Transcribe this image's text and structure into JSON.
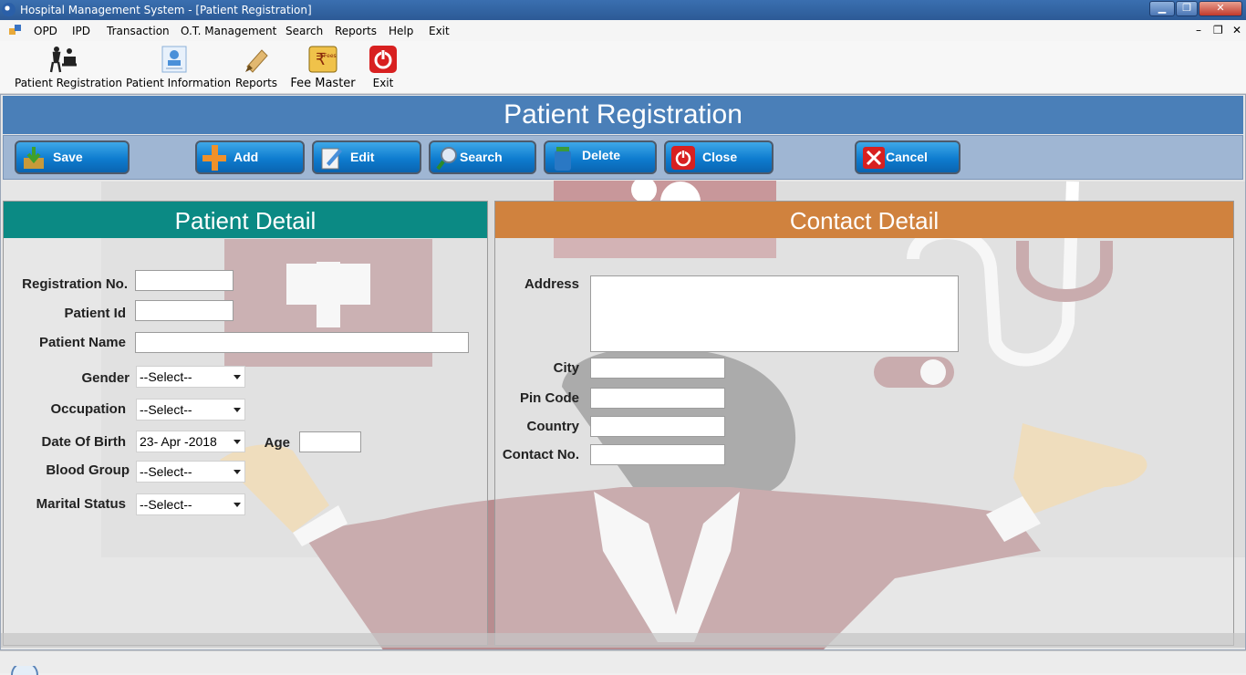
{
  "window": {
    "title": "Hospital Management System - [Patient Registration]",
    "min": "▁",
    "max": "❐",
    "close": "✕"
  },
  "menu": [
    "OPD",
    "IPD",
    "Transaction",
    "O.T. Management",
    "Search",
    "Reports",
    "Help",
    "Exit"
  ],
  "mdi_controls": {
    "min": "–",
    "restore": "❐",
    "close": "✕"
  },
  "toolbar": [
    "Patient Registration",
    "Patient Information",
    "Reports",
    "Fee Master",
    "Exit"
  ],
  "form": {
    "header": "Patient Registration",
    "actions": [
      "Save",
      "Add",
      "Edit",
      "Search",
      "Delete",
      "Close",
      "Cancel"
    ]
  },
  "patient_detail": {
    "title": "Patient Detail",
    "labels": {
      "registration_no": "Registration No.",
      "patient_id": "Patient Id",
      "patient_name": "Patient Name",
      "gender": "Gender",
      "occupation": "Occupation",
      "dob": "Date Of Birth",
      "age": "Age",
      "blood_group": "Blood Group",
      "marital_status": "Marital Status"
    },
    "values": {
      "gender": "--Select--",
      "occupation": "--Select--",
      "dob": "23- Apr -2018",
      "blood_group": "--Select--",
      "marital_status": "--Select--"
    }
  },
  "contact_detail": {
    "title": "Contact Detail",
    "labels": {
      "address": "Address",
      "city": "City",
      "pin_code": "Pin Code",
      "country": "Country",
      "contact_no": "Contact No."
    }
  },
  "colors": {
    "header_blue": "#4a7fb8",
    "patient_header": "#0b8a84",
    "contact_header": "#d0823e",
    "button_blue": "#0e7ccf"
  }
}
